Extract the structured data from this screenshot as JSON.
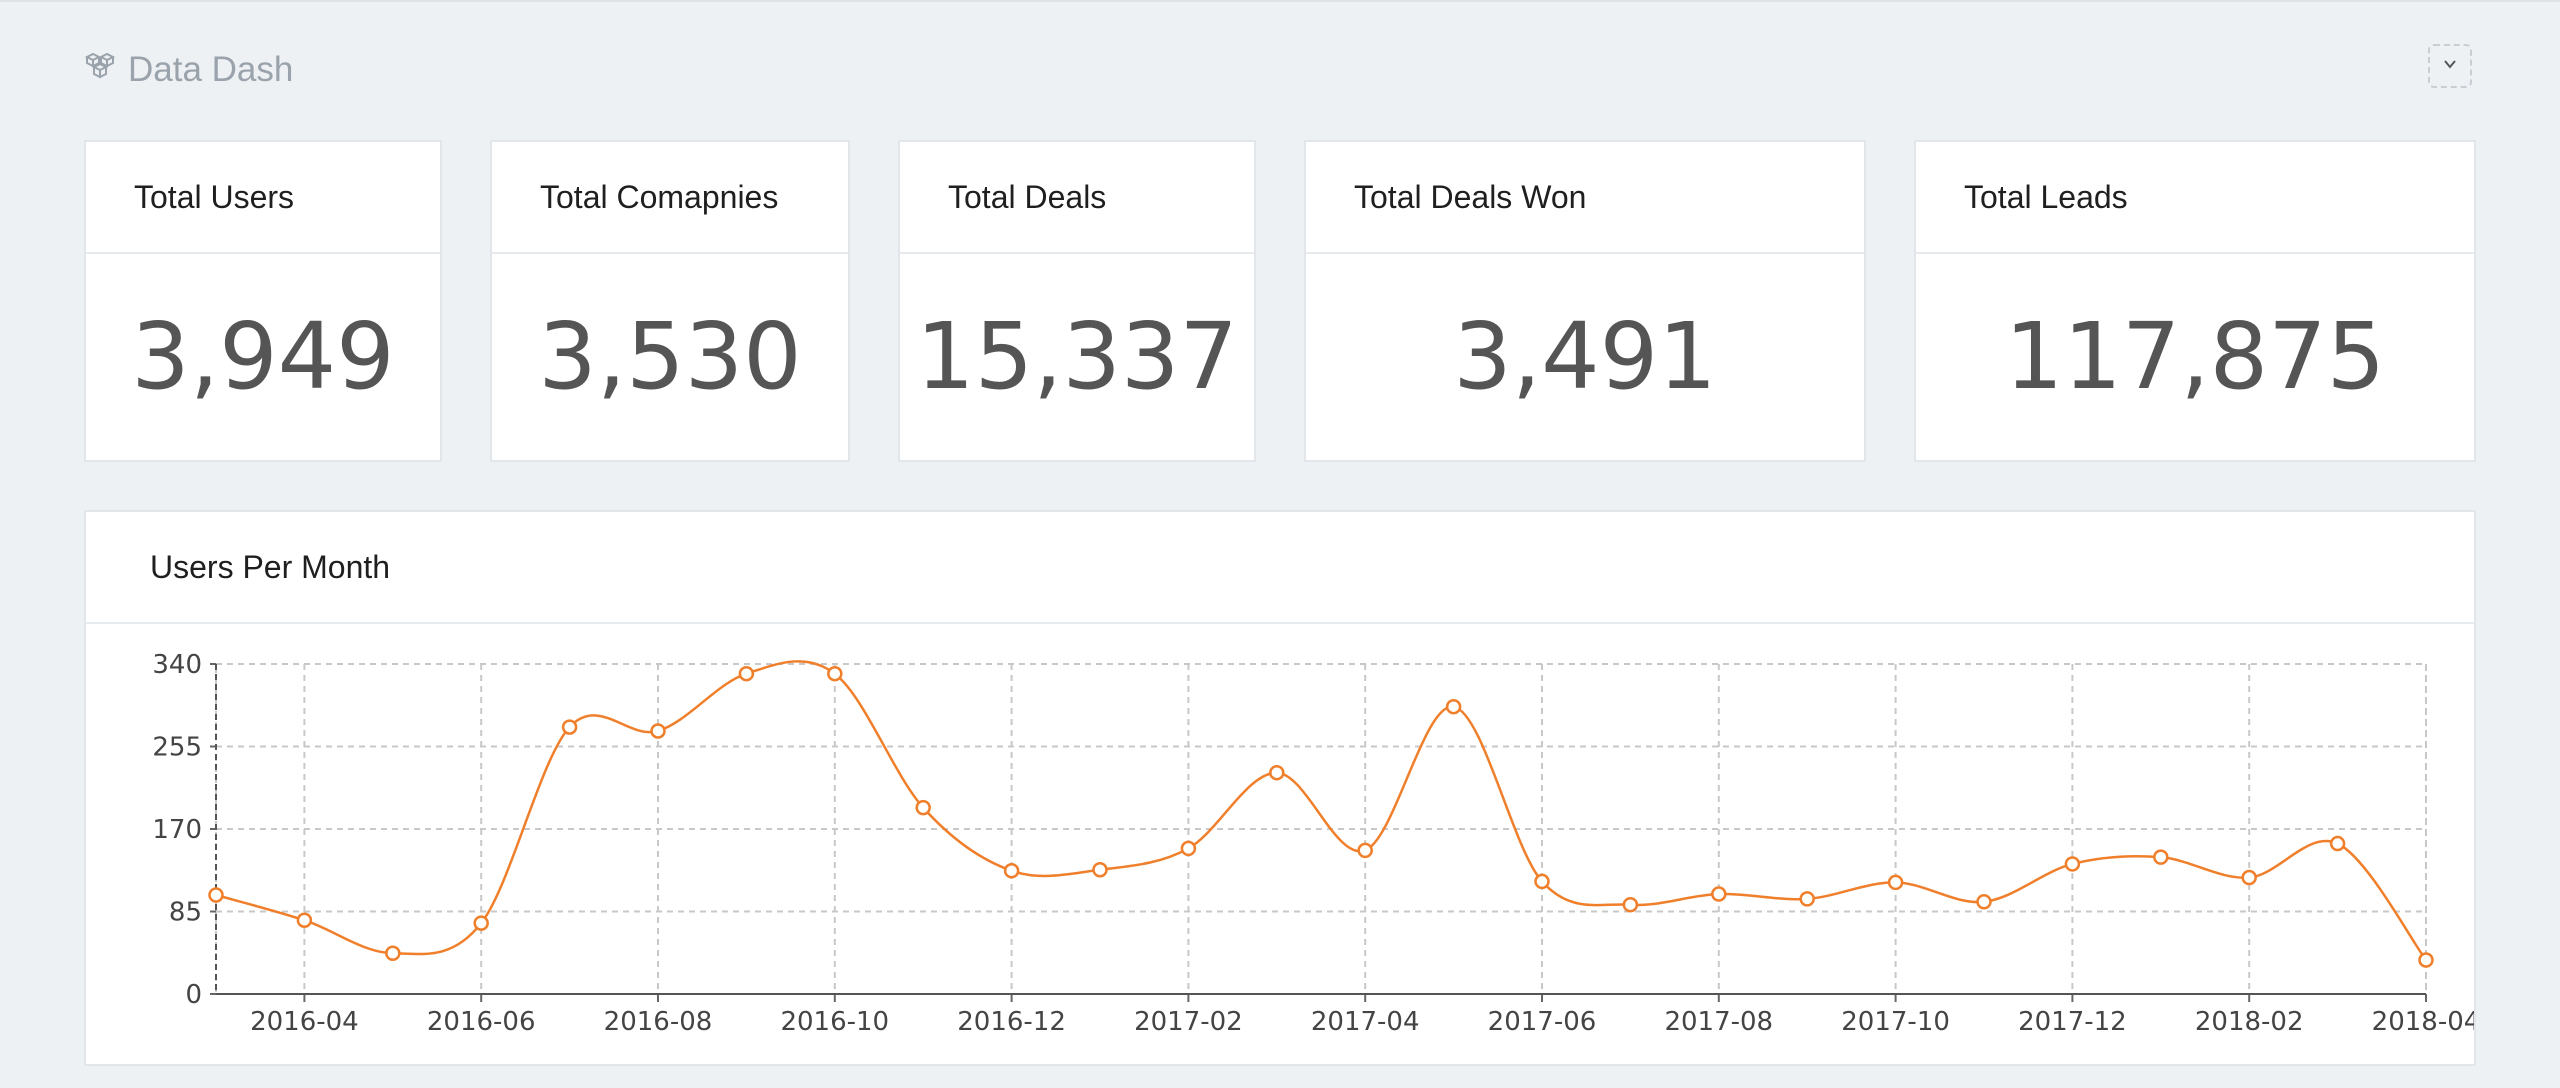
{
  "app": {
    "title": "Data Dash",
    "logo_icon": "cubes-icon",
    "menu_icon": "chevron-down-icon"
  },
  "stats": [
    {
      "label": "Total Users",
      "value": "3,949"
    },
    {
      "label": "Total Comapnies",
      "value": "3,530"
    },
    {
      "label": "Total Deals",
      "value": "15,337"
    },
    {
      "label": "Total Deals Won",
      "value": "3,491"
    },
    {
      "label": "Total Leads",
      "value": "117,875"
    }
  ],
  "chart": {
    "title": "Users Per Month"
  },
  "colors": {
    "line": "#f07f2b",
    "background": "#eef1f4",
    "grid": "#c8c8c8"
  },
  "chart_data": {
    "type": "line",
    "title": "Users Per Month",
    "xlabel": "",
    "ylabel": "",
    "x": [
      "2016-03",
      "2016-04",
      "2016-05",
      "2016-06",
      "2016-07",
      "2016-08",
      "2016-09",
      "2016-10",
      "2016-11",
      "2016-12",
      "2017-01",
      "2017-02",
      "2017-03",
      "2017-04",
      "2017-05",
      "2017-06",
      "2017-07",
      "2017-08",
      "2017-09",
      "2017-10",
      "2017-11",
      "2017-12",
      "2018-01",
      "2018-02",
      "2018-03",
      "2018-04"
    ],
    "series": [
      {
        "values": [
          102,
          76,
          42,
          73,
          275,
          271,
          330,
          330,
          192,
          127,
          128,
          150,
          228,
          148,
          296,
          116,
          92,
          103,
          98,
          115,
          95,
          134,
          141,
          120,
          155,
          35
        ]
      }
    ],
    "xticks": [
      "2016-04",
      "2016-06",
      "2016-08",
      "2016-10",
      "2016-12",
      "2017-02",
      "2017-04",
      "2017-06",
      "2017-08",
      "2017-10",
      "2017-12",
      "2018-02",
      "2018-04"
    ],
    "yticks": [
      0,
      85,
      170,
      255,
      340
    ],
    "ylim": [
      0,
      340
    ],
    "grid": true,
    "smooth": true,
    "markers": "hollow-circle"
  }
}
